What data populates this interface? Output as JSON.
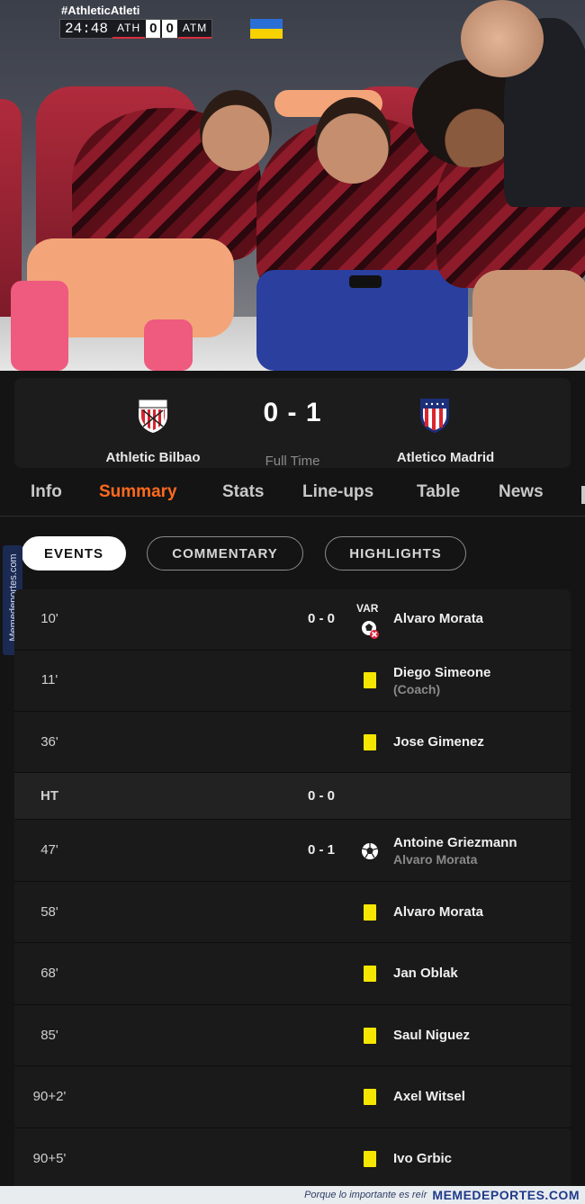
{
  "broadcast": {
    "hashtag": "#AthleticAtleti",
    "clock": "24:48",
    "home_code": "ATH",
    "home_score": "0",
    "away_score": "0",
    "away_code": "ATM"
  },
  "match": {
    "home_team": "Athletic Bilbao",
    "away_team": "Atletico Madrid",
    "score": "0 - 1",
    "status": "Full Time"
  },
  "tabs": [
    "Info",
    "Summary",
    "Stats",
    "Line-ups",
    "Table",
    "News"
  ],
  "active_tab": "Summary",
  "filters": [
    "EVENTS",
    "COMMENTARY",
    "HIGHLIGHTS"
  ],
  "active_filter": "EVENTS",
  "watermark_side": "Memedeportes.com",
  "events": [
    {
      "minute": "10'",
      "score": "0 - 0",
      "var": "VAR",
      "icon": "var-goal-disallowed-icon",
      "player": "Alvaro Morata",
      "sub": ""
    },
    {
      "minute": "11'",
      "score": "",
      "var": "",
      "icon": "yellow-card-icon",
      "player": "Diego Simeone",
      "sub": "(Coach)"
    },
    {
      "minute": "36'",
      "score": "",
      "var": "",
      "icon": "yellow-card-icon",
      "player": "Jose Gimenez",
      "sub": ""
    },
    {
      "minute": "HT",
      "score": "0 - 0",
      "var": "",
      "icon": "",
      "player": "",
      "sub": ""
    },
    {
      "minute": "47'",
      "score": "0 - 1",
      "var": "",
      "icon": "goal-ball-icon",
      "player": "Antoine Griezmann",
      "sub": "Alvaro Morata"
    },
    {
      "minute": "58'",
      "score": "",
      "var": "",
      "icon": "yellow-card-icon",
      "player": "Alvaro Morata",
      "sub": ""
    },
    {
      "minute": "68'",
      "score": "",
      "var": "",
      "icon": "yellow-card-icon",
      "player": "Jan Oblak",
      "sub": ""
    },
    {
      "minute": "85'",
      "score": "",
      "var": "",
      "icon": "yellow-card-icon",
      "player": "Saul Niguez",
      "sub": ""
    },
    {
      "minute": "90+2'",
      "score": "",
      "var": "",
      "icon": "yellow-card-icon",
      "player": "Axel Witsel",
      "sub": ""
    },
    {
      "minute": "90+5'",
      "score": "",
      "var": "",
      "icon": "yellow-card-icon",
      "player": "Ivo Grbic",
      "sub": ""
    }
  ],
  "footer": {
    "tagline": "Porque lo importante es reír",
    "brand": "MEMEDEPORTES.COM"
  },
  "colors": {
    "accent": "#ff6a1e",
    "background": "#141414",
    "yellow_card": "#f5e600"
  }
}
